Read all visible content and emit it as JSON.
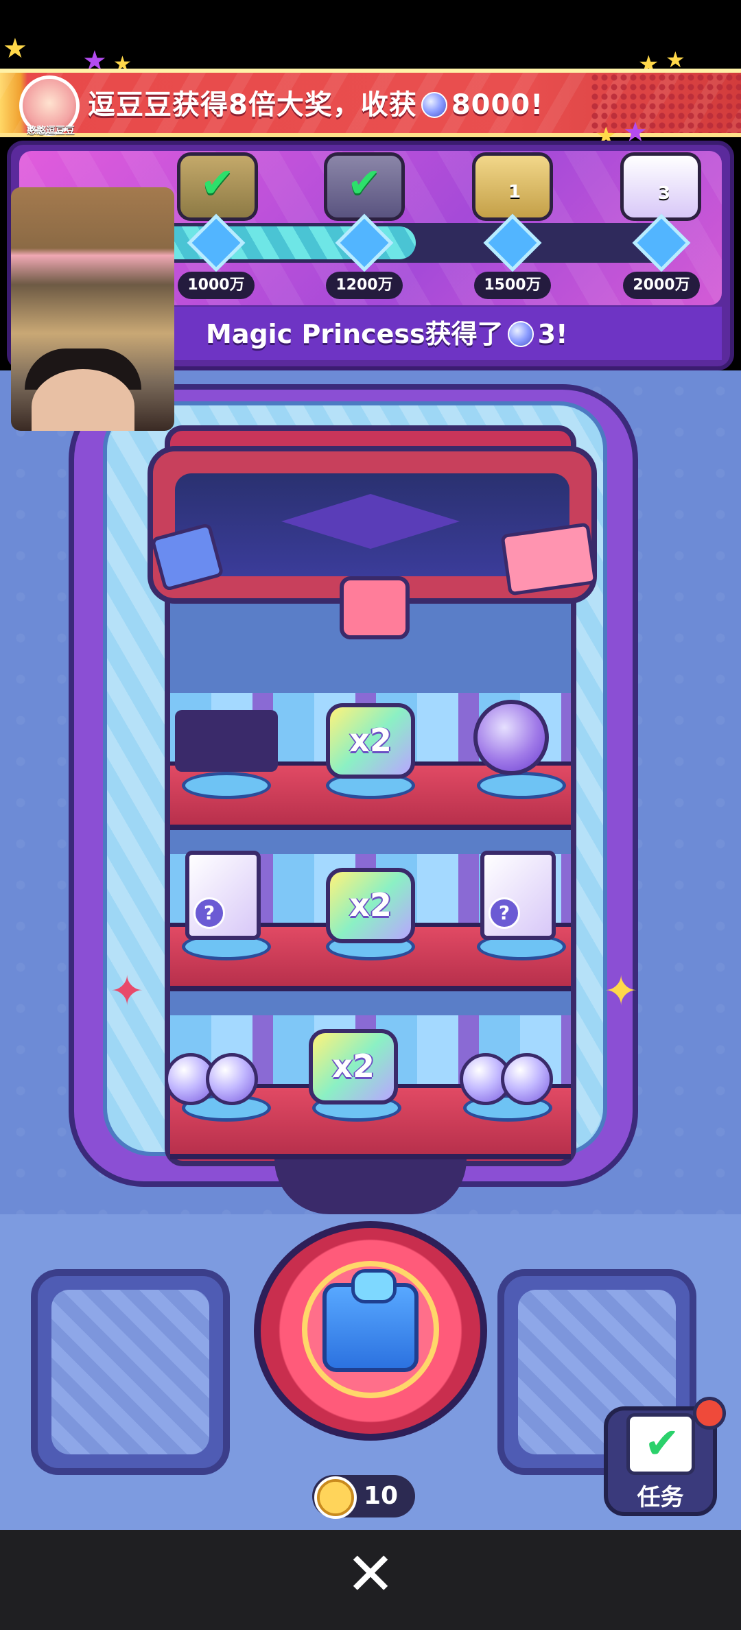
{
  "banner": {
    "text_prefix": "逗豆豆获得8倍大奖，收获",
    "amount": "8000!",
    "avatar_label": "憨憨逗豆豆"
  },
  "progress": {
    "fill_fraction": 0.52,
    "milestones": [
      "1000万",
      "1200万",
      "1500万",
      "2000万"
    ],
    "rewards": [
      {
        "icon": "claimed-check-icon",
        "status": "claimed"
      },
      {
        "icon": "claimed-check-icon",
        "status": "claimed"
      },
      {
        "icon": "machine-reward-icon",
        "count": "1"
      },
      {
        "icon": "mystery-box-icon",
        "count": "3"
      }
    ]
  },
  "announcement": {
    "text": "Magic Princess获得了",
    "count": "3!"
  },
  "prizes": {
    "row1": [
      "sticker-pack-icon",
      "x2",
      "capsule-icon"
    ],
    "row2": [
      "mystery-box-icon",
      "x2",
      "mystery-box-icon"
    ],
    "row3": [
      "orbs-icon",
      "x2",
      "orbs-icon"
    ],
    "x2_label": "x2",
    "question_label": "?"
  },
  "controls": {
    "coin_count": "10",
    "task_label": "任务",
    "close_glyph": "✕"
  },
  "colors": {
    "banner": "#e94f4f",
    "panel": "#5b2a9c",
    "machine": "#6d8bd6",
    "cabinet": "#c9355a",
    "accent": "#52b5ff"
  }
}
